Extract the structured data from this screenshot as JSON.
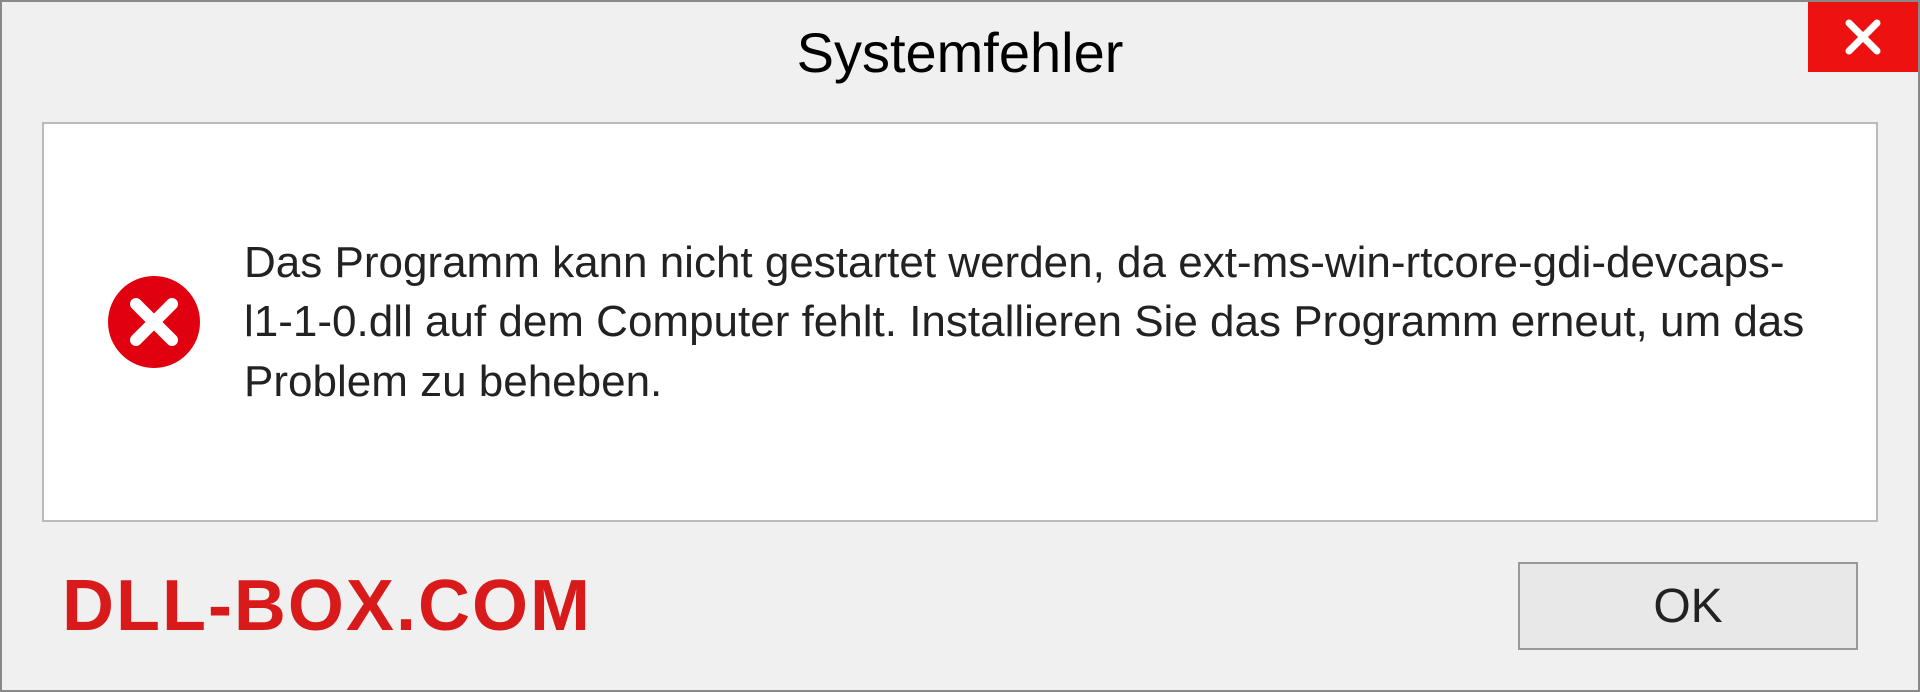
{
  "dialog": {
    "title": "Systemfehler",
    "message": "Das Programm kann nicht gestartet werden, da ext-ms-win-rtcore-gdi-devcaps-l1-1-0.dll auf dem Computer fehlt. Installieren Sie das Programm erneut, um das Problem zu beheben.",
    "ok_label": "OK"
  },
  "watermark": "DLL-BOX.COM"
}
